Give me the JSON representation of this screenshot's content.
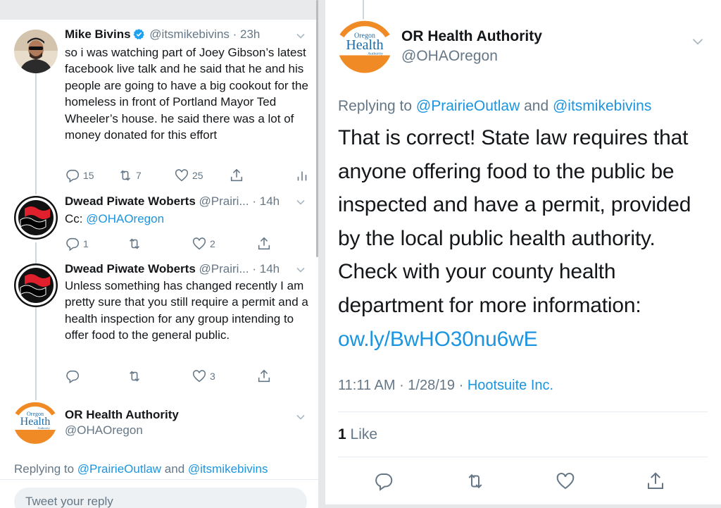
{
  "left": {
    "tweets": [
      {
        "name": "Mike Bivins",
        "handle": "@itsmikebivins · 23h",
        "text": "so i was watching part of Joey Gibson’s latest facebook live talk and he said that he and his people are going to have a big cookout for the homeless in front of Portland Mayor Ted Wheeler’s house. he said there was a lot of money donated for this effort",
        "replies": "15",
        "retweets": "7",
        "likes": "25"
      },
      {
        "name": "Dwead Piwate Woberts",
        "handle": "@Prairi... · 14h",
        "text_prefix": "Cc: ",
        "mention": "@OHAOregon",
        "replies": "1",
        "likes": "2"
      },
      {
        "name": "Dwead Piwate Woberts",
        "handle": "@Prairi... · 14h",
        "text": "Unless something has changed recently I am pretty sure that you still require a permit and a health inspection for any group intending to offer food to the general public.",
        "likes": "3"
      }
    ],
    "focus": {
      "name": "OR Health Authority",
      "handle": "@OHAOregon",
      "replying_prefix": "Replying to ",
      "replying_to_1": "@PrairieOutlaw",
      "replying_and": " and ",
      "replying_to_2": "@itsmikebivins"
    },
    "reply_placeholder": "Tweet your reply"
  },
  "right": {
    "name": "OR Health Authority",
    "handle": "@OHAOregon",
    "replying_prefix": "Replying to ",
    "replying_to_1": "@PrairieOutlaw",
    "replying_and": " and ",
    "replying_to_2": "@itsmikebivins",
    "text": "That is correct! State law requires that anyone offering food to the public be inspected and have a permit, provided by the local public health authority. Check with your county health department for more information:",
    "link": "ow.ly/BwHO30nu6wE",
    "time": "11:11 AM · 1/28/19 · ",
    "source": "Hootsuite Inc.",
    "likes_count": "1",
    "likes_label": " Like"
  },
  "logo": {
    "top_text": "Oregon",
    "main_text": "Health",
    "bottom_text": "Authority"
  },
  "colors": {
    "link": "#1b95e0",
    "muted": "#657786",
    "oha_orange": "#f08a24",
    "verified": "#1da1f2"
  }
}
